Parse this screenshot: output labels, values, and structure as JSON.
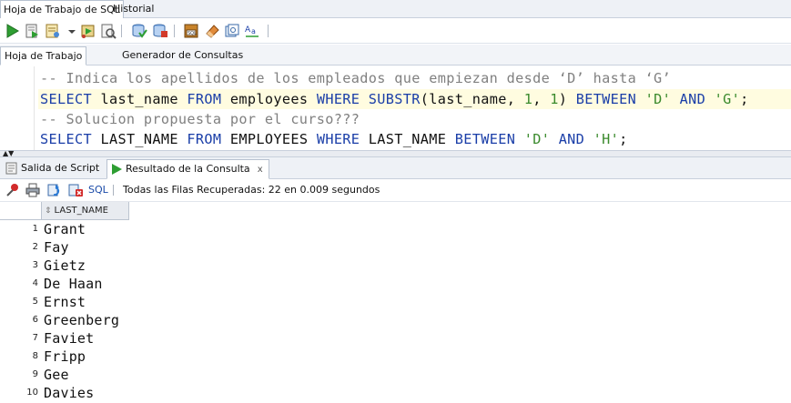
{
  "doc_tabs": [
    {
      "label": "Hoja de Trabajo de SQL",
      "active": true
    },
    {
      "label": "Historial",
      "active": false
    }
  ],
  "toolbar": {
    "buttons": [
      "run-statement-icon",
      "run-script-icon",
      "explain-plan-icon",
      "dropdown-arrow-icon",
      "autotrace-icon",
      "sql-tuning-icon",
      "commit-icon",
      "rollback-icon",
      "unshared-sql-icon",
      "clear-eraser-icon",
      "format-sql-icon",
      "change-case-icon"
    ]
  },
  "sub_tabs": [
    {
      "label": "Hoja de Trabajo",
      "active": true
    },
    {
      "label": "Generador de Consultas",
      "active": false
    }
  ],
  "editor": {
    "lines": [
      {
        "type": "comment",
        "text": "-- Indica los apellidos de los empleados que empiezan desde ‘D’ hasta ‘G’"
      },
      {
        "type": "sql1",
        "parts": [
          "SELECT",
          " last_name ",
          "FROM",
          " employees ",
          "WHERE",
          " ",
          "SUBSTR",
          "(last_name, ",
          "1",
          ", ",
          "1",
          ") ",
          "BETWEEN",
          " ",
          "'D'",
          " ",
          "AND",
          " ",
          "'G'",
          ";"
        ]
      },
      {
        "type": "comment",
        "text": "-- Solucion propuesta por el curso???"
      },
      {
        "type": "sql2",
        "parts": [
          "SELECT",
          " LAST_NAME ",
          "FROM",
          " EMPLOYEES ",
          "WHERE",
          " LAST_NAME ",
          "BETWEEN",
          " ",
          "'D'",
          " ",
          "AND",
          " ",
          "'H'",
          ";"
        ]
      }
    ]
  },
  "result_tabs": [
    {
      "label": "Salida de Script",
      "close": "x",
      "active": false
    },
    {
      "label": "Resultado de la Consulta",
      "close": "x",
      "active": true
    }
  ],
  "result_toolbar": {
    "sql_label": "SQL",
    "status": "Todas las Filas Recuperadas: 22 en 0.009 segundos"
  },
  "grid": {
    "column": "LAST_NAME",
    "rows": [
      {
        "n": "1",
        "v": "Grant"
      },
      {
        "n": "2",
        "v": "Fay"
      },
      {
        "n": "3",
        "v": "Gietz"
      },
      {
        "n": "4",
        "v": "De Haan"
      },
      {
        "n": "5",
        "v": "Ernst"
      },
      {
        "n": "6",
        "v": "Greenberg"
      },
      {
        "n": "7",
        "v": "Faviet"
      },
      {
        "n": "8",
        "v": "Fripp"
      },
      {
        "n": "9",
        "v": "Gee"
      },
      {
        "n": "10",
        "v": "Davies"
      }
    ]
  },
  "colors": {
    "keyword": "#1a3ea8",
    "string": "#3a8a2c",
    "comment": "#808080",
    "current_line": "#fffce0"
  }
}
